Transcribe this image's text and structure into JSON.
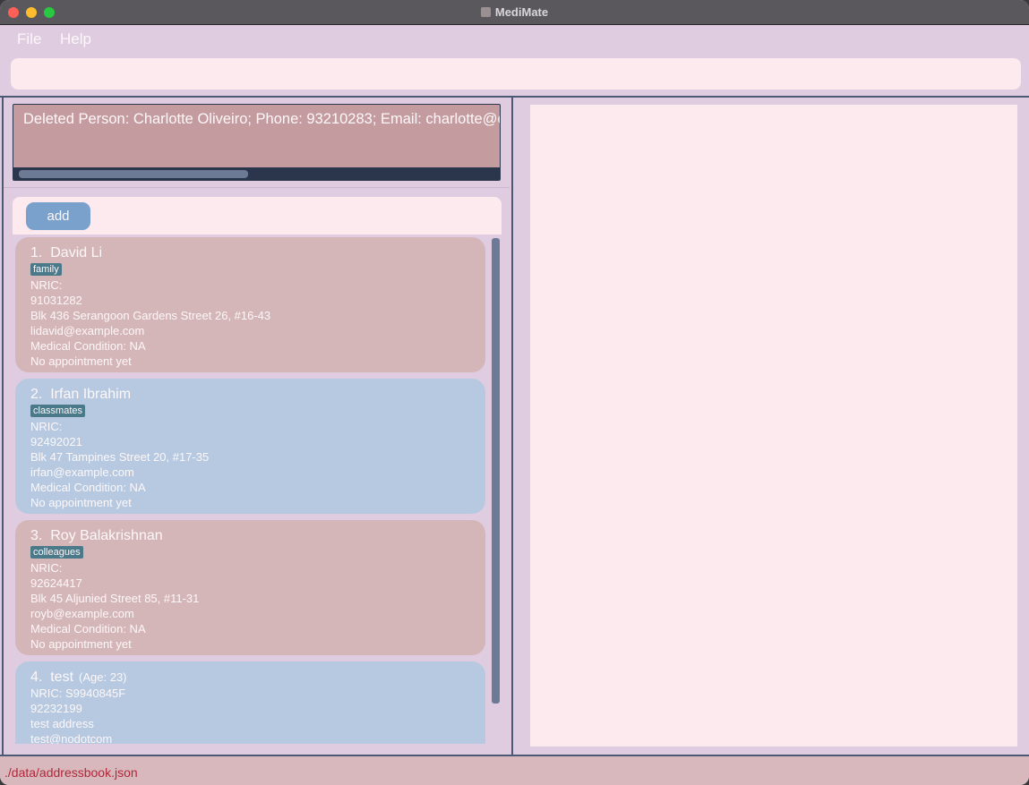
{
  "window": {
    "title": "MediMate"
  },
  "menu": {
    "file": "File",
    "help": "Help"
  },
  "command_box": {
    "value": ""
  },
  "result_display": {
    "text": "Deleted Person: Charlotte Oliveiro; Phone: 93210283; Email: charlotte@ex"
  },
  "toolbar": {
    "add_label": "add"
  },
  "persons": [
    {
      "index": "1.",
      "name": "David Li",
      "age": "",
      "tag": "family",
      "nric": "NRIC:",
      "phone": "91031282",
      "address": "Blk 436 Serangoon Gardens Street 26, #16-43",
      "email": "lidavid@example.com",
      "medical": "Medical Condition: NA",
      "appointment": "No appointment yet"
    },
    {
      "index": "2.",
      "name": "Irfan Ibrahim",
      "age": "",
      "tag": "classmates",
      "nric": "NRIC:",
      "phone": "92492021",
      "address": "Blk 47 Tampines Street 20, #17-35",
      "email": "irfan@example.com",
      "medical": "Medical Condition: NA",
      "appointment": "No appointment yet"
    },
    {
      "index": "3.",
      "name": "Roy Balakrishnan",
      "age": "",
      "tag": "colleagues",
      "nric": "NRIC:",
      "phone": "92624417",
      "address": "Blk 45 Aljunied Street 85, #11-31",
      "email": "royb@example.com",
      "medical": "Medical Condition: NA",
      "appointment": "No appointment yet"
    },
    {
      "index": "4.",
      "name": "test",
      "age": "(Age: 23)",
      "tag": "",
      "nric": "NRIC: S9940845F",
      "phone": "92232199",
      "address": "test address",
      "email": "test@nodotcom",
      "medical": "",
      "appointment": ""
    }
  ],
  "status_bar": {
    "path": "./data/addressbook.json"
  },
  "colors": {
    "window_bg": "#e0cce0",
    "card_pink": "#d5b6b8",
    "card_blue": "#b6c9e0",
    "tag": "#4a7a8a",
    "accent_button": "#7aa0cc",
    "status_text": "#b0283a"
  }
}
